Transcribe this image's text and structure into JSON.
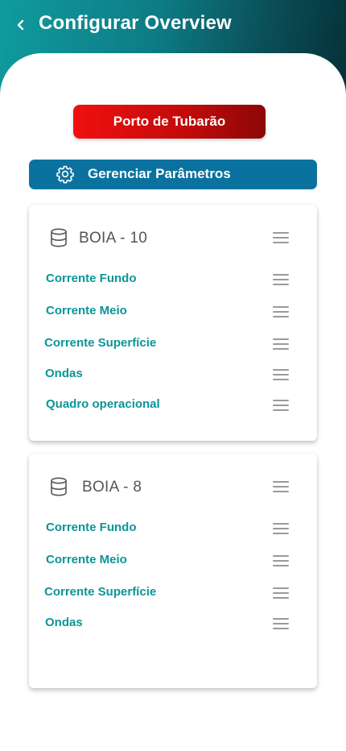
{
  "header": {
    "title": "Configurar Overview",
    "back_icon": "chevron-left-icon"
  },
  "location": {
    "label": "Porto de Tubarão"
  },
  "params": {
    "label": "Gerenciar Parâmetros",
    "icon": "gear-icon"
  },
  "cards": [
    {
      "title": "BOIA - 10",
      "icon": "database-icon",
      "items": [
        {
          "label": "Corrente Fundo"
        },
        {
          "label": "Corrente Meio"
        },
        {
          "label": "Corrente Superfície"
        },
        {
          "label": "Ondas"
        },
        {
          "label": "Quadro operacional"
        }
      ]
    },
    {
      "title": "BOIA - 8",
      "icon": "database-icon",
      "items": [
        {
          "label": "Corrente Fundo"
        },
        {
          "label": "Corrente Meio"
        },
        {
          "label": "Corrente Superfície"
        },
        {
          "label": "Ondas"
        }
      ]
    }
  ],
  "colors": {
    "header_start": "#0f9c9f",
    "header_end": "#053038",
    "location_button": "#e01010",
    "params_button": "#0b72a0",
    "item_text": "#0b9598"
  }
}
